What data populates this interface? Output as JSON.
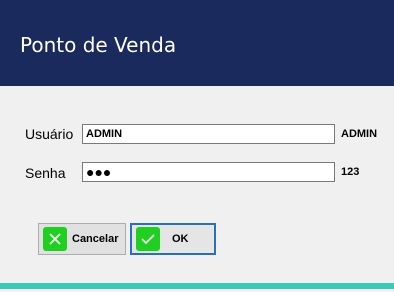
{
  "header": {
    "title": "Ponto de Venda"
  },
  "form": {
    "usuario_label": "Usuário",
    "usuario_value": "ADMIN",
    "usuario_side": "ADMIN",
    "senha_label": "Senha",
    "senha_value": "●●●",
    "senha_side": "123"
  },
  "buttons": {
    "cancel_label": "Cancelar",
    "ok_label": "OK"
  },
  "icons": {
    "cancel": "close-icon",
    "ok": "check-icon"
  },
  "colors": {
    "header_bg": "#1b2a5c",
    "accent_bar": "#3cc8b4",
    "icon_green": "#20d020",
    "ok_border": "#2b6fb6"
  }
}
